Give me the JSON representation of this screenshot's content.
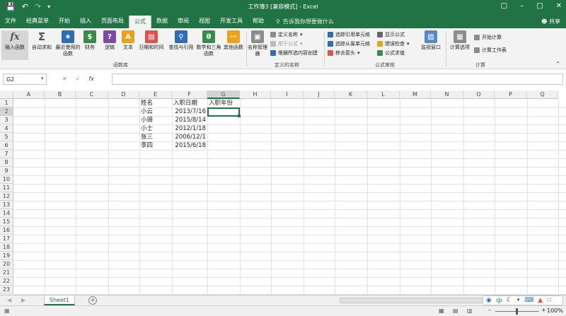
{
  "window": {
    "title": "工作簿3 [兼容模式] - Excel"
  },
  "tabs": [
    {
      "label": "文件"
    },
    {
      "label": "经典菜单"
    },
    {
      "label": "开始"
    },
    {
      "label": "插入"
    },
    {
      "label": "页面布局"
    },
    {
      "label": "公式"
    },
    {
      "label": "数据"
    },
    {
      "label": "审阅"
    },
    {
      "label": "视图"
    },
    {
      "label": "开发工具"
    },
    {
      "label": "帮助"
    }
  ],
  "tellme": "告诉我你想要做什么",
  "share": "共享",
  "ribbon": {
    "function_library": {
      "insert_function": "插入函数",
      "autosum": "自动求和",
      "recent": "最近使用的函数",
      "financial": "财务",
      "logical": "逻辑",
      "text": "文本",
      "datetime": "日期和时间",
      "lookup": "查找与引用",
      "math": "数学和三角函数",
      "more": "其他函数",
      "group": "函数库"
    },
    "defined_names": {
      "name_manager": "名称管理器",
      "define_name": "定义名称",
      "use_in_formula": "用于公式",
      "create_from_selection": "根据所选内容创建",
      "group": "定义的名称"
    },
    "auditing": {
      "trace_precedents": "追踪引用单元格",
      "trace_dependents": "追踪从属单元格",
      "remove_arrows": "移去箭头",
      "show_formulas": "显示公式",
      "error_checking": "错误检查",
      "evaluate": "公式求值",
      "watch": "监视窗口",
      "group": "公式审核"
    },
    "calculation": {
      "options": "计算选项",
      "calc_now": "开始计算",
      "calc_sheet": "计算工作表",
      "group": "计算"
    }
  },
  "formula_bar": {
    "name_box": "G2",
    "fx": "fx",
    "content": ""
  },
  "columns": [
    "A",
    "B",
    "C",
    "D",
    "E",
    "F",
    "G",
    "H",
    "I",
    "J",
    "K",
    "L",
    "M",
    "N",
    "O",
    "P",
    "Q"
  ],
  "rows": [
    "1",
    "2",
    "3",
    "4",
    "5",
    "6",
    "7",
    "8",
    "9",
    "10",
    "11",
    "12",
    "13",
    "14",
    "15",
    "16",
    "17",
    "18",
    "19",
    "20",
    "21",
    "22",
    "23"
  ],
  "cells": {
    "E1": "姓名",
    "F1": "入职日期",
    "G1": "入职年份",
    "E2": "小云",
    "F2": "2013/7/16",
    "E3": "小骑",
    "F3": "2015/8/14",
    "E4": "小士",
    "F4": "2012/1/18",
    "E5": "张三",
    "F5": "2006/12/1",
    "E6": "李四",
    "F6": "2015/6/18"
  },
  "sheet": {
    "name": "Sheet1"
  },
  "status": {
    "zoom": "100%"
  },
  "colors": {
    "accent": "#217346"
  }
}
